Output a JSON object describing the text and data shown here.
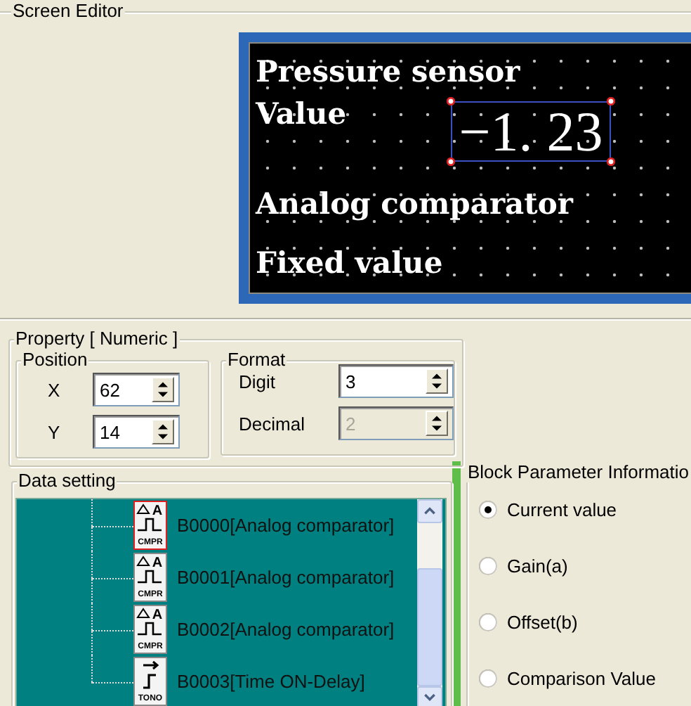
{
  "screen_editor": {
    "title": "Screen Editor",
    "lines": [
      {
        "text": "Pressure sensor"
      },
      {
        "text": "Value",
        "value": "−1. 23",
        "selected": true
      },
      {
        "text": "Analog comparator"
      },
      {
        "text": "Fixed value"
      }
    ]
  },
  "property": {
    "title": "Property [ Numeric ]",
    "position": {
      "title": "Position",
      "fields": [
        {
          "label": "X",
          "value": "62",
          "disabled": false
        },
        {
          "label": "Y",
          "value": "14",
          "disabled": false
        }
      ]
    },
    "format": {
      "title": "Format",
      "fields": [
        {
          "label": "Digit",
          "value": "3",
          "disabled": false
        },
        {
          "label": "Decimal",
          "value": "2",
          "disabled": true
        }
      ]
    }
  },
  "data_setting": {
    "title": "Data setting",
    "items": [
      {
        "kind": "comparator",
        "label": "B0000[Analog comparator]",
        "icon_letter": "A",
        "icon_caption": "CMPR",
        "selected": true
      },
      {
        "kind": "comparator",
        "label": "B0001[Analog comparator]",
        "icon_letter": "A",
        "icon_caption": "CMPR",
        "selected": false
      },
      {
        "kind": "comparator",
        "label": "B0002[Analog comparator]",
        "icon_letter": "A",
        "icon_caption": "CMPR",
        "selected": false
      },
      {
        "kind": "timer",
        "label": "B0003[Time ON-Delay]",
        "icon_caption": "TONO",
        "selected": false
      }
    ]
  },
  "block_parameter": {
    "title": "Block Parameter Informatio",
    "options": [
      {
        "label": "Current value",
        "selected": true
      },
      {
        "label": "Gain(a)",
        "selected": false
      },
      {
        "label": "Offset(b)",
        "selected": false
      },
      {
        "label": "Comparison Value",
        "selected": false
      }
    ]
  }
}
